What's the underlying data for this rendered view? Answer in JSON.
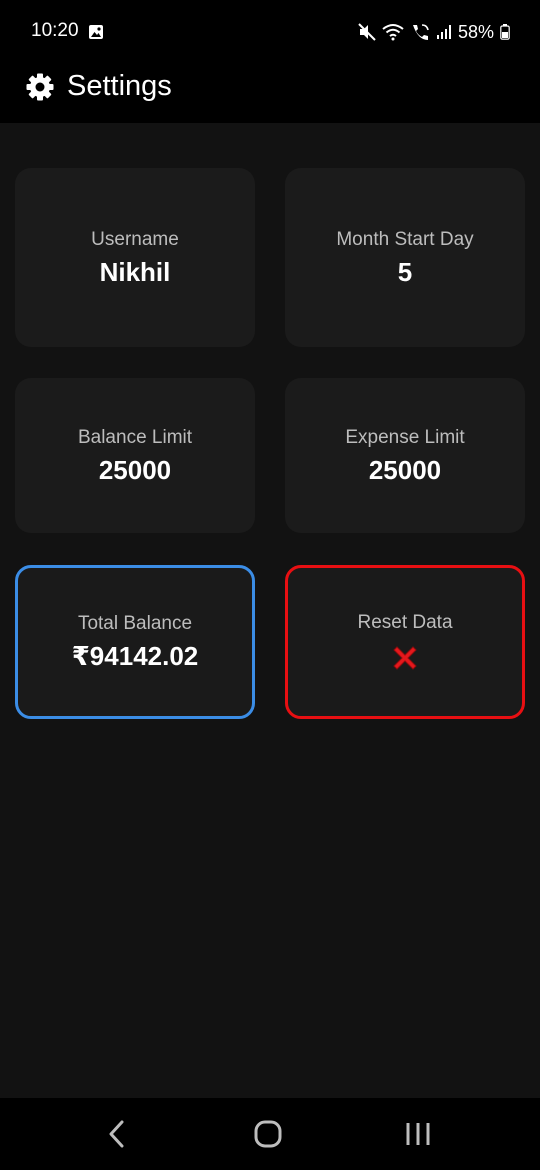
{
  "status_bar": {
    "time": "10:20",
    "battery": "58%",
    "icons": [
      "gallery-icon",
      "mute-icon",
      "wifi-icon",
      "wifi-call-icon",
      "signal-icon",
      "battery-icon"
    ]
  },
  "app_bar": {
    "title": "Settings",
    "icon": "gear-icon"
  },
  "cards": [
    {
      "label": "Username",
      "value": "Nikhil"
    },
    {
      "label": "Month Start Day",
      "value": "5"
    },
    {
      "label": "Balance Limit",
      "value": "25000"
    },
    {
      "label": "Expense Limit",
      "value": "25000"
    },
    {
      "label": "Total Balance",
      "value": "₹94142.02"
    },
    {
      "label": "Reset Data",
      "icon": "red-x-icon"
    }
  ],
  "colors": {
    "background": "#121212",
    "card": "#1b1b1b",
    "total_balance_border": "#3b8de6",
    "reset_border": "#e80f12"
  },
  "nav_bar": {
    "icons": [
      "back-icon",
      "home-icon",
      "recents-icon"
    ]
  }
}
